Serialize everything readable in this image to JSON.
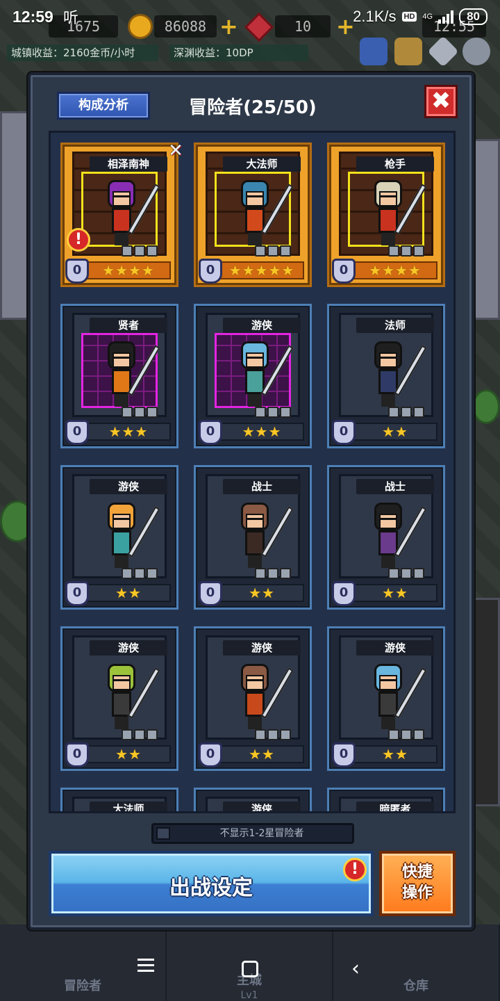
{
  "status_bar": {
    "time": "12:59",
    "app_badge": "听",
    "net_speed": "2.1K/s",
    "hd_label": "HD",
    "network": "4G",
    "battery": "80"
  },
  "hud": {
    "resource_1": "1675",
    "gold": "86088",
    "gems": "10",
    "timer": "12:55",
    "town_income": "城镇收益：2160金币/小时",
    "abyss_income": "深渊收益：10DP"
  },
  "dialog": {
    "analysis_button": "构成分析",
    "title": "冒险者(25/50)",
    "close_icon": "✖",
    "filter_label": "不显示1-2星冒险者",
    "sortie_button": "出战设定",
    "quick_button": "快捷\n操作"
  },
  "heroes": [
    {
      "name": "相泽南神",
      "stars": "★★★★",
      "level": "0",
      "rarity": "gold",
      "hair": "#8a2db5",
      "outfit": "#c8321e",
      "alert": true,
      "swords": true,
      "weapon": "sword"
    },
    {
      "name": "大法师",
      "stars": "★★★★★",
      "level": "0",
      "rarity": "gold",
      "hair": "#3a86b0",
      "outfit": "#d24a1c",
      "weapon": "staff"
    },
    {
      "name": "枪手",
      "stars": "★★★★",
      "level": "0",
      "rarity": "gold",
      "hair": "#d7d2b8",
      "outfit": "#c8321e",
      "weapon": "spear"
    },
    {
      "name": "贤者",
      "stars": "★★★",
      "level": "0",
      "rarity": "purple",
      "hair": "#1f1f1f",
      "outfit": "#e07818",
      "weapon": "hammer"
    },
    {
      "name": "游侠",
      "stars": "★★★",
      "level": "0",
      "rarity": "purple",
      "hair": "#69b6df",
      "outfit": "#4aa09a",
      "weapon": "bow"
    },
    {
      "name": "法师",
      "stars": "★★",
      "level": "0",
      "rarity": "plain",
      "hair": "#1f1f1f",
      "outfit": "#2f3b66",
      "weapon": "staff"
    },
    {
      "name": "游侠",
      "stars": "★★",
      "level": "0",
      "rarity": "plain",
      "hair": "#f2a33a",
      "outfit": "#3aa0a0",
      "weapon": "bow"
    },
    {
      "name": "战士",
      "stars": "★★",
      "level": "0",
      "rarity": "plain",
      "hair": "#8a5a44",
      "outfit": "#3b2a24",
      "weapon": "sword"
    },
    {
      "name": "战士",
      "stars": "★★",
      "level": "0",
      "rarity": "plain",
      "hair": "#1f1f1f",
      "outfit": "#6a3a8c",
      "weapon": "sword"
    },
    {
      "name": "游侠",
      "stars": "★★",
      "level": "0",
      "rarity": "plain",
      "hair": "#9cc23a",
      "outfit": "#3a3a3a",
      "weapon": "bow"
    },
    {
      "name": "游侠",
      "stars": "★★",
      "level": "0",
      "rarity": "plain",
      "hair": "#8a5a44",
      "outfit": "#c84a1c",
      "weapon": "bow"
    },
    {
      "name": "游侠",
      "stars": "★★",
      "level": "0",
      "rarity": "plain",
      "hair": "#69b6df",
      "outfit": "#3a3a3a",
      "weapon": "bow"
    },
    {
      "name": "大法师",
      "stars": "",
      "level": "",
      "rarity": "plain",
      "hair": "",
      "outfit": "",
      "weapon": ""
    },
    {
      "name": "游侠",
      "stars": "",
      "level": "",
      "rarity": "plain",
      "hair": "",
      "outfit": "",
      "weapon": ""
    },
    {
      "name": "暗匿者",
      "stars": "",
      "level": "",
      "rarity": "plain",
      "hair": "",
      "outfit": "",
      "weapon": ""
    }
  ],
  "game_nav": [
    {
      "label": "冒险者",
      "sub": ""
    },
    {
      "label": "主城",
      "sub": "Lv1"
    },
    {
      "label": "仓库",
      "sub": ""
    }
  ],
  "colors": {
    "accent_blue": "#3d7fd2",
    "accent_orange": "#ff7a1c",
    "gold_card": "#efa22a",
    "alert_red": "#d62828"
  }
}
